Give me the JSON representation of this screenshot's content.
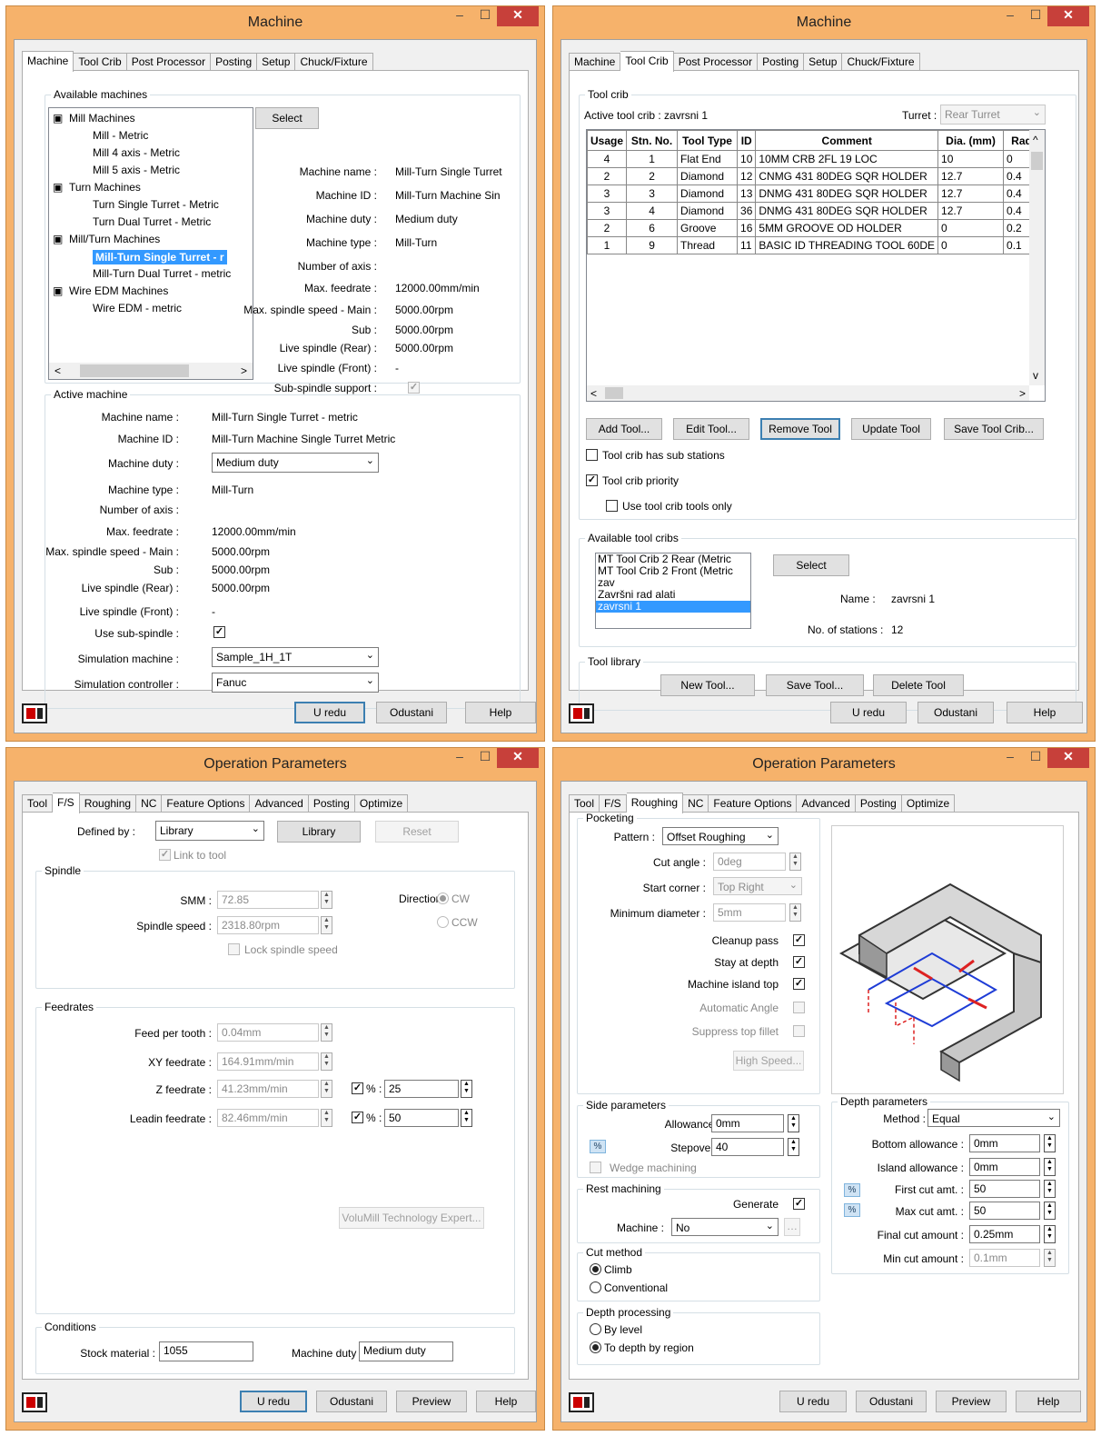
{
  "machine_dialog": {
    "title": "Machine",
    "tabs": [
      "Machine",
      "Tool Crib",
      "Post Processor",
      "Posting",
      "Setup",
      "Chuck/Fixture"
    ],
    "available_label": "Available machines",
    "tree": [
      {
        "label": "Mill Machines",
        "level": 0
      },
      {
        "label": "Mill - Metric",
        "level": 1
      },
      {
        "label": "Mill 4 axis - Metric",
        "level": 1
      },
      {
        "label": "Mill 5 axis - Metric",
        "level": 1
      },
      {
        "label": "Turn Machines",
        "level": 0
      },
      {
        "label": "Turn Single Turret - Metric",
        "level": 1
      },
      {
        "label": "Turn Dual Turret - Metric",
        "level": 1
      },
      {
        "label": "Mill/Turn Machines",
        "level": 0
      },
      {
        "label": "Mill-Turn Single Turret - r",
        "level": 1,
        "selected": true
      },
      {
        "label": "Mill-Turn Dual Turret - metric",
        "level": 1
      },
      {
        "label": "Wire EDM Machines",
        "level": 0
      },
      {
        "label": "Wire EDM - metric",
        "level": 1
      }
    ],
    "select_btn": "Select",
    "info": [
      {
        "k": "Machine name :",
        "v": "Mill-Turn Single Turret"
      },
      {
        "k": "Machine ID :",
        "v": "Mill-Turn Machine Sin"
      },
      {
        "k": "Machine duty :",
        "v": "Medium duty"
      },
      {
        "k": "Machine type :",
        "v": "Mill-Turn"
      },
      {
        "k": "Number of axis :",
        "v": ""
      },
      {
        "k": "Max. feedrate :",
        "v": "12000.00mm/min"
      },
      {
        "k": "Max. spindle speed - Main :",
        "v": "5000.00rpm"
      },
      {
        "k": "Sub :",
        "v": "5000.00rpm"
      },
      {
        "k": "Live spindle (Rear) :",
        "v": "5000.00rpm"
      },
      {
        "k": "Live spindle (Front) :",
        "v": "-"
      },
      {
        "k": "Sub-spindle support :",
        "v": ""
      }
    ],
    "active_label": "Active machine",
    "active": {
      "name_k": "Machine name :",
      "name_v": "Mill-Turn Single Turret - metric",
      "id_k": "Machine ID :",
      "id_v": "Mill-Turn Machine Single Turret Metric",
      "duty_k": "Machine duty :",
      "duty_v": "Medium duty",
      "type_k": "Machine type :",
      "type_v": "Mill-Turn",
      "axis_k": "Number of axis :",
      "feed_k": "Max. feedrate :",
      "feed_v": "12000.00mm/min",
      "main_k": "Max. spindle speed - Main :",
      "main_v": "5000.00rpm",
      "sub_k": "Sub :",
      "sub_v": "5000.00rpm",
      "rear_k": "Live spindle (Rear) :",
      "rear_v": "5000.00rpm",
      "front_k": "Live spindle (Front) :",
      "front_v": "-",
      "usesub_k": "Use sub-spindle :",
      "sim_k": "Simulation machine :",
      "sim_v": "Sample_1H_1T",
      "ctrl_k": "Simulation controller :",
      "ctrl_v": "Fanuc"
    },
    "ok": "U redu",
    "cancel": "Odustani",
    "help": "Help"
  },
  "toolcrib_dialog": {
    "title": "Machine",
    "tabs": [
      "Machine",
      "Tool Crib",
      "Post Processor",
      "Posting",
      "Setup",
      "Chuck/Fixture"
    ],
    "group": "Tool crib",
    "active_crib": "Active tool crib :  zavrsni 1",
    "turret_k": "Turret :",
    "turret_v": "Rear Turret",
    "columns": [
      "Usage",
      "Stn. No.",
      "Tool Type",
      "ID",
      "Comment",
      "Dia. (mm)",
      "Rad"
    ],
    "rows": [
      [
        "4",
        "1",
        "Flat End",
        "10",
        "10MM CRB 2FL 19 LOC",
        "10",
        "0"
      ],
      [
        "2",
        "2",
        "Diamond",
        "12",
        "CNMG 431 80DEG SQR HOLDER",
        "12.7",
        "0.4"
      ],
      [
        "3",
        "3",
        "Diamond",
        "13",
        "DNMG 431 80DEG SQR HOLDER",
        "12.7",
        "0.4"
      ],
      [
        "3",
        "4",
        "Diamond",
        "36",
        "DNMG 431 80DEG SQR HOLDER",
        "12.7",
        "0.4"
      ],
      [
        "2",
        "6",
        "Groove",
        "16",
        "5MM GROOVE OD HOLDER",
        "0",
        "0.2"
      ],
      [
        "1",
        "9",
        "Thread",
        "11",
        "BASIC ID THREADING TOOL 60DE",
        "0",
        "0.1"
      ]
    ],
    "btns": [
      "Add Tool...",
      "Edit Tool...",
      "Remove Tool",
      "Update Tool",
      "Save Tool Crib..."
    ],
    "chk1": "Tool crib has sub stations",
    "chk2": "Tool crib priority",
    "chk3": "Use tool crib tools only",
    "avail_group": "Available tool cribs",
    "cribs": [
      "MT Tool Crib 2 Rear (Metric",
      "MT Tool Crib 2 Front (Metric",
      "zav",
      "Završni rad alati",
      "zavrsni 1"
    ],
    "select_btn": "Select",
    "name_k": "Name :",
    "name_v": "zavrsni 1",
    "stations_k": "No. of stations :",
    "stations_v": "12",
    "lib_group": "Tool library",
    "lib_btns": [
      "New Tool...",
      "Save Tool...",
      "Delete Tool"
    ],
    "ok": "U redu",
    "cancel": "Odustani",
    "help": "Help"
  },
  "fs_dialog": {
    "title": "Operation Parameters",
    "tabs": [
      "Tool",
      "F/S",
      "Roughing",
      "NC",
      "Feature Options",
      "Advanced",
      "Posting",
      "Optimize"
    ],
    "defined_k": "Defined by :",
    "defined_v": "Library",
    "library_btn": "Library",
    "reset_btn": "Reset",
    "link": "Link to tool",
    "spindle_group": "Spindle",
    "smm_k": "SMM :",
    "smm_v": "72.85",
    "speed_k": "Spindle speed :",
    "speed_v": "2318.80rpm",
    "dir_k": "Direction :",
    "cw": "CW",
    "ccw": "CCW",
    "lock": "Lock spindle speed",
    "feed_group": "Feedrates",
    "fpt_k": "Feed per tooth :",
    "fpt_v": "0.04mm",
    "xy_k": "XY feedrate :",
    "xy_v": "164.91mm/min",
    "z_k": "Z feedrate :",
    "z_v": "41.23mm/min",
    "z_pct_k": "% :",
    "z_pct": "25",
    "lead_k": "Leadin feedrate :",
    "lead_v": "82.46mm/min",
    "lead_pct_k": "% :",
    "lead_pct": "50",
    "volu": "VoluMill Technology Expert...",
    "cond_group": "Conditions",
    "stock_k": "Stock material :",
    "stock_v": "1055",
    "duty_k": "Machine duty :",
    "duty_v": "Medium duty",
    "ok": "U redu",
    "cancel": "Odustani",
    "preview": "Preview",
    "help": "Help"
  },
  "rough_dialog": {
    "title": "Operation Parameters",
    "tabs": [
      "Tool",
      "F/S",
      "Roughing",
      "NC",
      "Feature Options",
      "Advanced",
      "Posting",
      "Optimize"
    ],
    "pocket_group": "Pocketing",
    "pattern_k": "Pattern :",
    "pattern_v": "Offset Roughing",
    "angle_k": "Cut angle :",
    "angle_v": "0deg",
    "corner_k": "Start corner :",
    "corner_v": "Top Right",
    "mindia_k": "Minimum diameter :",
    "mindia_v": "5mm",
    "cleanup": "Cleanup pass",
    "stay": "Stay at depth",
    "island": "Machine island top",
    "auto": "Automatic Angle",
    "suppress": "Suppress top fillet",
    "highspeed": "High Speed...",
    "side_group": "Side parameters",
    "allow_k": "Allowance :",
    "allow_v": "0mm",
    "step_k": "Stepover :",
    "step_v": "40",
    "wedge": "Wedge machining",
    "rest_group": "Rest machining",
    "generate": "Generate",
    "mach_k": "Machine :",
    "mach_v": "No",
    "cut_group": "Cut method",
    "climb": "Climb",
    "conv": "Conventional",
    "dp_group": "Depth processing",
    "bylevel": "By level",
    "todepth": "To depth by region",
    "depth_group": "Depth parameters",
    "method_k": "Method :",
    "method_v": "Equal",
    "bottom_k": "Bottom allowance :",
    "bottom_v": "0mm",
    "isl_k": "Island allowance :",
    "isl_v": "0mm",
    "first_k": "First cut amt. :",
    "first_v": "50",
    "max_k": "Max cut amt. :",
    "max_v": "50",
    "final_k": "Final cut amount :",
    "final_v": "0.25mm",
    "min_k": "Min cut amount :",
    "min_v": "0.1mm",
    "ok": "U redu",
    "cancel": "Odustani",
    "preview": "Preview",
    "help": "Help"
  }
}
